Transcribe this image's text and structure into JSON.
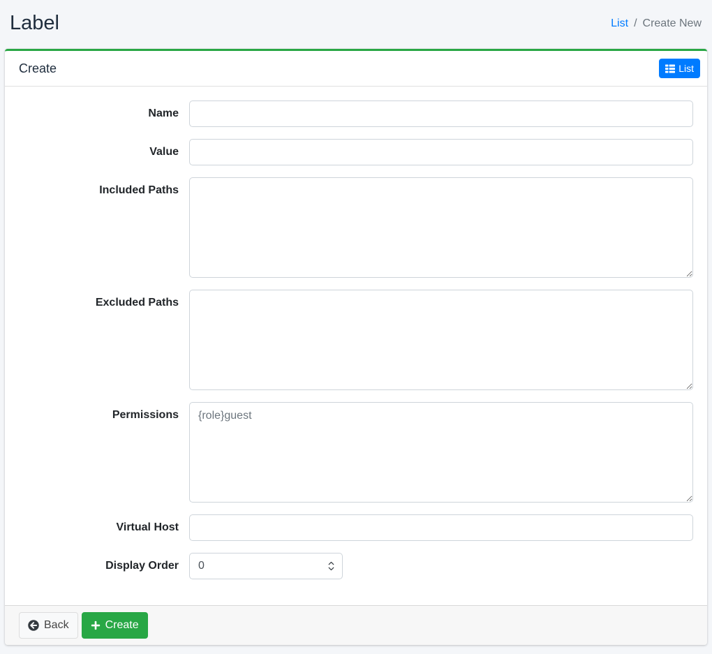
{
  "page": {
    "title": "Label"
  },
  "breadcrumb": {
    "list_label": "List",
    "separator": "/",
    "current_label": "Create New"
  },
  "card": {
    "title": "Create",
    "list_button": {
      "label": "List",
      "icon": "th-list-icon"
    }
  },
  "form": {
    "fields": [
      {
        "label": "Name",
        "type": "text",
        "value": "",
        "placeholder": ""
      },
      {
        "label": "Value",
        "type": "text",
        "value": "",
        "placeholder": ""
      },
      {
        "label": "Included Paths",
        "type": "textarea",
        "value": "",
        "placeholder": ""
      },
      {
        "label": "Excluded Paths",
        "type": "textarea",
        "value": "",
        "placeholder": ""
      },
      {
        "label": "Permissions",
        "type": "textarea",
        "value": "",
        "placeholder": "{role}guest"
      },
      {
        "label": "Virtual Host",
        "type": "text",
        "value": "",
        "placeholder": ""
      },
      {
        "label": "Display Order",
        "type": "number",
        "value": "0"
      }
    ]
  },
  "footer": {
    "back_button": {
      "label": "Back",
      "icon": "arrow-circle-left-icon"
    },
    "create_button": {
      "label": "Create",
      "icon": "plus-icon"
    }
  },
  "colors": {
    "accent_green": "#28a745",
    "primary_blue": "#007bff",
    "page_background": "#f4f6f9",
    "muted_text": "#6c757d",
    "footer_background": "#f7f7f7"
  }
}
